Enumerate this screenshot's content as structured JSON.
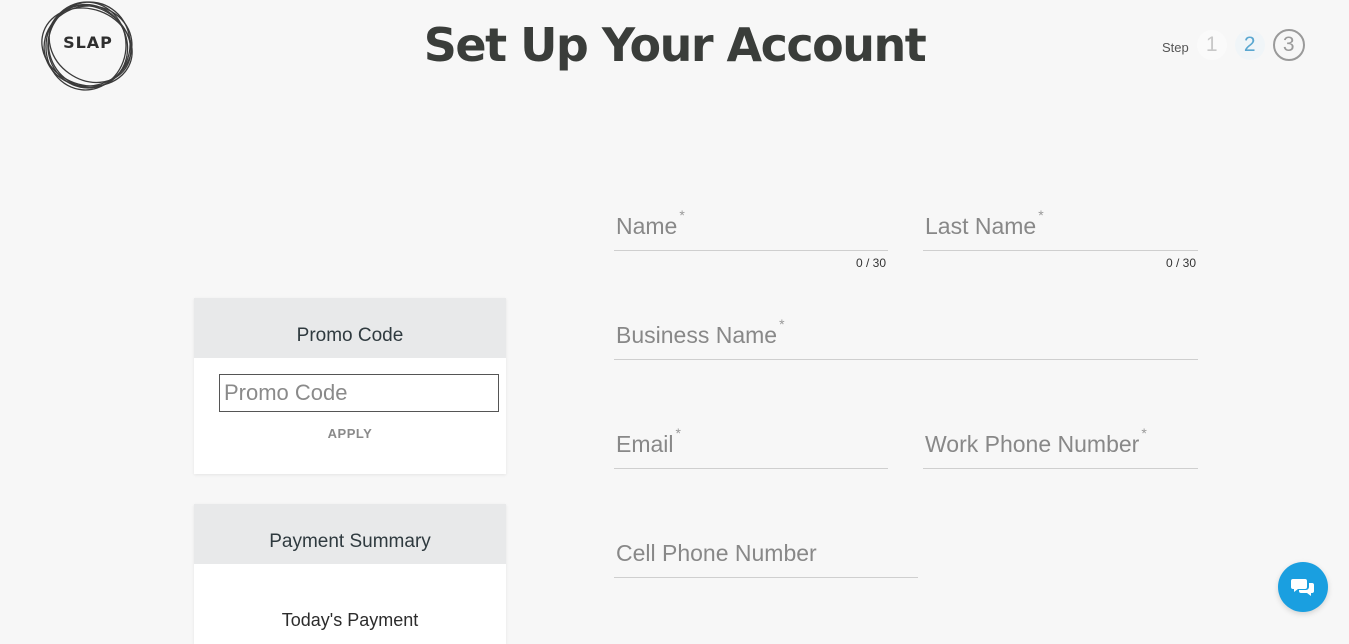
{
  "header": {
    "logo_text": "SLAP",
    "title": "Set Up Your Account",
    "step_label": "Step",
    "steps": [
      "1",
      "2",
      "3"
    ],
    "current_step": "3"
  },
  "promo": {
    "title": "Promo Code",
    "input_placeholder": "Promo Code",
    "apply_label": "APPLY"
  },
  "summary": {
    "title": "Payment Summary",
    "today_label": "Today's Payment"
  },
  "form": {
    "name": {
      "label": "Name",
      "required": "*",
      "counter": "0 / 30"
    },
    "last_name": {
      "label": "Last Name",
      "required": "*",
      "counter": "0 / 30"
    },
    "business_name": {
      "label": "Business Name",
      "required": "*"
    },
    "email": {
      "label": "Email",
      "required": "*"
    },
    "work_phone": {
      "label": "Work Phone Number",
      "required": "*"
    },
    "cell_phone": {
      "label": "Cell Phone Number"
    }
  },
  "colors": {
    "background": "#f7f7f7",
    "accent_blue": "#1a9fe0",
    "step_active": "#5aa7d0",
    "card_header": "#e8e9ea"
  },
  "icons": {
    "logo": "slap-scribble-logo",
    "chat": "chat-bubbles-icon"
  }
}
